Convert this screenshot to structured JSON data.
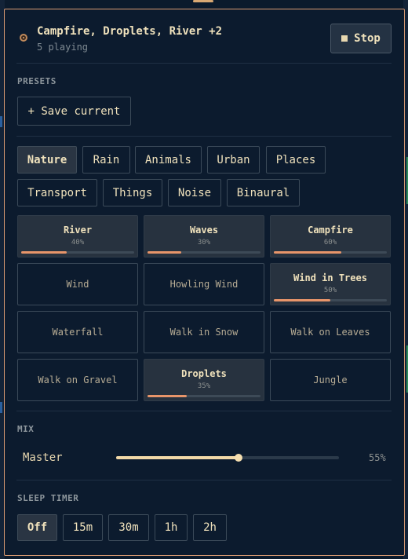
{
  "now_playing": {
    "title": "Campfire, Droplets, River +2",
    "subtitle": "5 playing",
    "stop_label": "Stop"
  },
  "presets": {
    "label": "PRESETS",
    "save_label": "+ Save current"
  },
  "categories": [
    {
      "label": "Nature",
      "active": true
    },
    {
      "label": "Rain",
      "active": false
    },
    {
      "label": "Animals",
      "active": false
    },
    {
      "label": "Urban",
      "active": false
    },
    {
      "label": "Places",
      "active": false
    },
    {
      "label": "Transport",
      "active": false
    },
    {
      "label": "Things",
      "active": false
    },
    {
      "label": "Noise",
      "active": false
    },
    {
      "label": "Binaural",
      "active": false
    }
  ],
  "sounds": [
    {
      "name": "River",
      "active": true,
      "volume": 40,
      "volume_label": "40%"
    },
    {
      "name": "Waves",
      "active": true,
      "volume": 30,
      "volume_label": "30%"
    },
    {
      "name": "Campfire",
      "active": true,
      "volume": 60,
      "volume_label": "60%"
    },
    {
      "name": "Wind",
      "active": false
    },
    {
      "name": "Howling Wind",
      "active": false
    },
    {
      "name": "Wind in Trees",
      "active": true,
      "volume": 50,
      "volume_label": "50%"
    },
    {
      "name": "Waterfall",
      "active": false
    },
    {
      "name": "Walk in Snow",
      "active": false
    },
    {
      "name": "Walk on Leaves",
      "active": false
    },
    {
      "name": "Walk on Gravel",
      "active": false
    },
    {
      "name": "Droplets",
      "active": true,
      "volume": 35,
      "volume_label": "35%"
    },
    {
      "name": "Jungle",
      "active": false
    }
  ],
  "mix": {
    "label": "MIX",
    "master_label": "Master",
    "master_value": 55,
    "master_value_label": "55%"
  },
  "sleep_timer": {
    "label": "SLEEP TIMER",
    "options": [
      {
        "label": "Off",
        "active": true
      },
      {
        "label": "15m",
        "active": false
      },
      {
        "label": "30m",
        "active": false
      },
      {
        "label": "1h",
        "active": false
      },
      {
        "label": "2h",
        "active": false
      }
    ]
  },
  "colors": {
    "accent": "#e8956a",
    "border_highlight": "#d99a72",
    "background": "#0c1b2e"
  }
}
